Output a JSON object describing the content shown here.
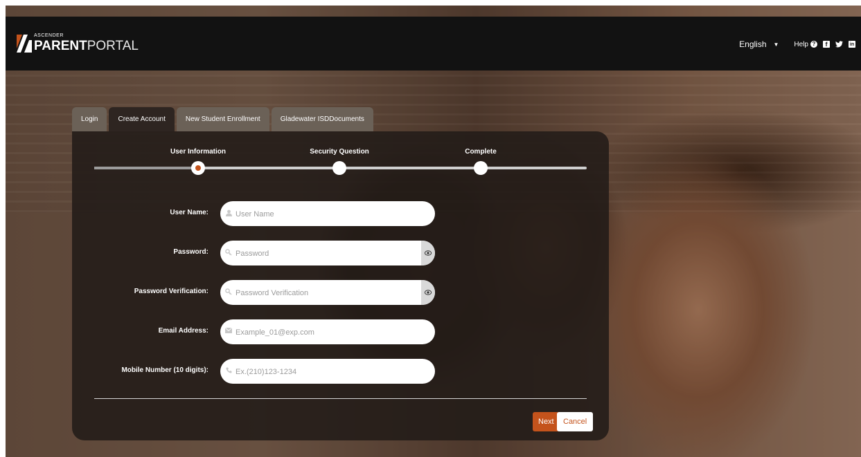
{
  "header": {
    "logo_small": "ASCENDER",
    "logo_bold": "PARENT",
    "logo_thin": "PORTAL",
    "language": "English",
    "help_label": "Help"
  },
  "tabs": [
    {
      "label": "Login",
      "active": false
    },
    {
      "label": "Create Account",
      "active": true
    },
    {
      "label": "New Student Enrollment",
      "active": false
    },
    {
      "label": "Gladewater ISDDocuments",
      "active": false
    }
  ],
  "steps": [
    {
      "label": "User Information",
      "current": true
    },
    {
      "label": "Security Question",
      "current": false
    },
    {
      "label": "Complete",
      "current": false
    }
  ],
  "form": {
    "username": {
      "label": "User Name:",
      "placeholder": "User Name",
      "value": ""
    },
    "password": {
      "label": "Password:",
      "placeholder": "Password",
      "value": ""
    },
    "password_verification": {
      "label": "Password Verification:",
      "placeholder": "Password Verification",
      "value": ""
    },
    "email": {
      "label": "Email Address:",
      "placeholder": "Example_01@exp.com",
      "value": ""
    },
    "mobile": {
      "label": "Mobile Number (10 digits):",
      "placeholder": "Ex.(210)123-1234",
      "value": ""
    }
  },
  "buttons": {
    "next": "Next",
    "cancel": "Cancel"
  },
  "colors": {
    "accent": "#c4531c",
    "header_bg": "#121212",
    "panel_bg": "#221b18"
  }
}
